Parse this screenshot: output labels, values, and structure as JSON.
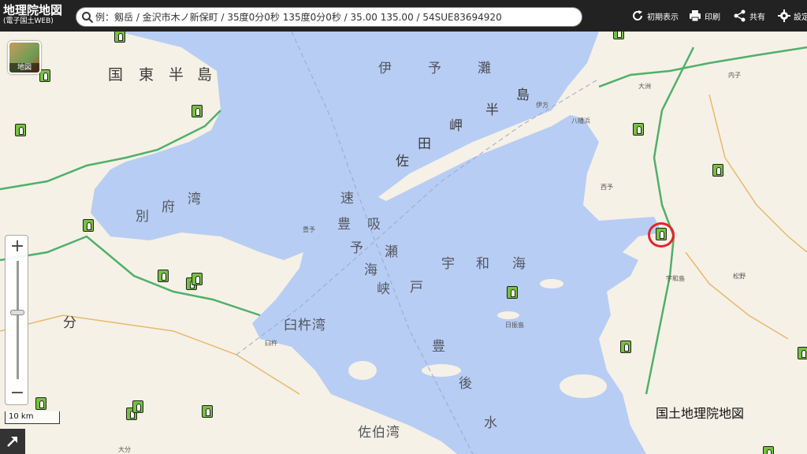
{
  "header": {
    "logo_title": "地理院地図",
    "logo_subtitle": "(電子国土WEB)",
    "search_placeholder": "例：剱岳 / 金沢市木ノ新保町 / 35度0分0秒 135度0分0秒 / 35.00 135.00 / 54SUE83694920",
    "buttons": {
      "initial_view": "初期表示",
      "print": "印刷",
      "share": "共有",
      "settings": "設定"
    }
  },
  "map_type": {
    "label": "地図"
  },
  "zoom": {
    "in_label": "+",
    "out_label": "−"
  },
  "scale_bar": {
    "label": "10 km"
  },
  "attribution": "国土地理院地図",
  "colors": {
    "sea": "#b8cdf4",
    "land": "#f6f1e6",
    "highlight": "#e4242b",
    "marker": "#76c23f",
    "header": "#222222"
  },
  "places": {
    "kunisaki": [
      "国",
      "東",
      "半",
      "島"
    ],
    "iyonada": [
      "伊",
      "予",
      "灘"
    ],
    "sadamisaki": [
      "佐",
      "田",
      "岬",
      "半",
      "島"
    ],
    "beppuwan": [
      "別",
      "府",
      "湾"
    ],
    "hoyo": [
      "速",
      "豊",
      "予",
      "吸",
      "海",
      "瀬",
      "峡",
      "戸"
    ],
    "uwakai": [
      "宇",
      "和",
      "海"
    ],
    "usukiwan": "臼杵湾",
    "saikiwan": "佐伯湾",
    "bungo": [
      "豊",
      "後",
      "水"
    ],
    "oita": "分"
  },
  "labels": {
    "oita_town": "大分",
    "usuki": "臼杵",
    "hiburi": "日振島",
    "nishiuwa": "西予",
    "yawatahama": "八幡浜",
    "uwajima": "宇和島",
    "matsuno": "松野",
    "hoyo_label": "豊予",
    "ikata": "伊方",
    "ozu": "大洲",
    "uchiko": "内子"
  }
}
